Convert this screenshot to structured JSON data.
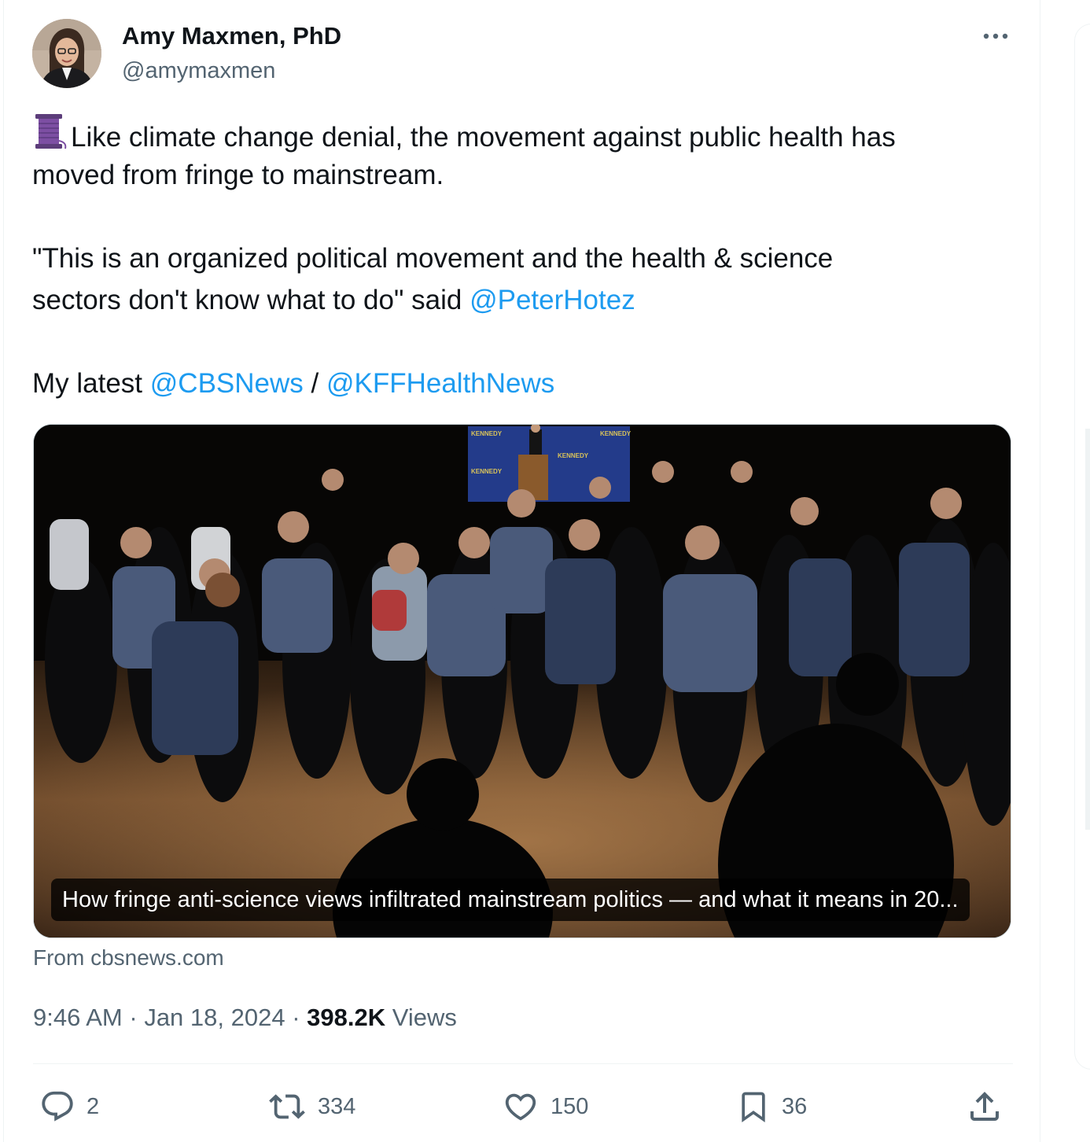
{
  "author": {
    "name": "Amy Maxmen, PhD",
    "handle": "@amymaxmen"
  },
  "tweet": {
    "line1": "Like climate change denial, the movement against public health has",
    "line2": "moved from fringe to mainstream.",
    "line3": "\"This is an organized political movement and the health & science",
    "line4": "sectors don't know what to do\" said ",
    "mention_hotez": "@PeterHotez",
    "line5_prefix": "My latest ",
    "mention_cbs": "@CBSNews",
    "separator": " / ",
    "mention_kff": "@KFFHealthNews"
  },
  "card": {
    "caption": "How fringe anti-science views infiltrated mainstream politics — and what it means in 20...",
    "source": "From cbsnews.com",
    "banner_text": "KENNEDY"
  },
  "meta": {
    "time": "9:46 AM",
    "dot1": " · ",
    "date": "Jan 18, 2024",
    "dot2": " · ",
    "views_count": "398.2K",
    "views_label": " Views"
  },
  "actions": {
    "replies": "2",
    "reposts": "334",
    "likes": "150",
    "bookmarks": "36"
  },
  "icons": [
    "thread-spool-icon",
    "more-icon",
    "reply-icon",
    "repost-icon",
    "like-icon",
    "bookmark-icon",
    "share-icon"
  ],
  "colors": {
    "link": "#1d9bf0",
    "secondary_text": "#536471",
    "primary_text": "#0f1419",
    "border": "#cfd9de"
  }
}
